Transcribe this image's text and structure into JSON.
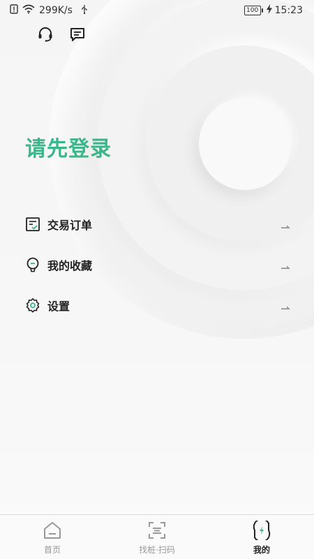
{
  "status_bar": {
    "speed": "299K/s",
    "battery": "100",
    "time": "15:23"
  },
  "login": {
    "title": "请先登录"
  },
  "menu": {
    "items": [
      {
        "label": "交易订单",
        "icon": "order-icon"
      },
      {
        "label": "我的收藏",
        "icon": "favorite-icon"
      },
      {
        "label": "设置",
        "icon": "settings-gear-icon"
      }
    ]
  },
  "bottom_nav": {
    "items": [
      {
        "label": "首页",
        "icon": "home-icon"
      },
      {
        "label": "找桩·扫码",
        "icon": "scan-icon"
      },
      {
        "label": "我的",
        "icon": "leaf-bolt-icon"
      }
    ],
    "active_index": 2
  },
  "colors": {
    "accent": "#3bb58a",
    "text": "#222222",
    "inactive": "#999999"
  }
}
